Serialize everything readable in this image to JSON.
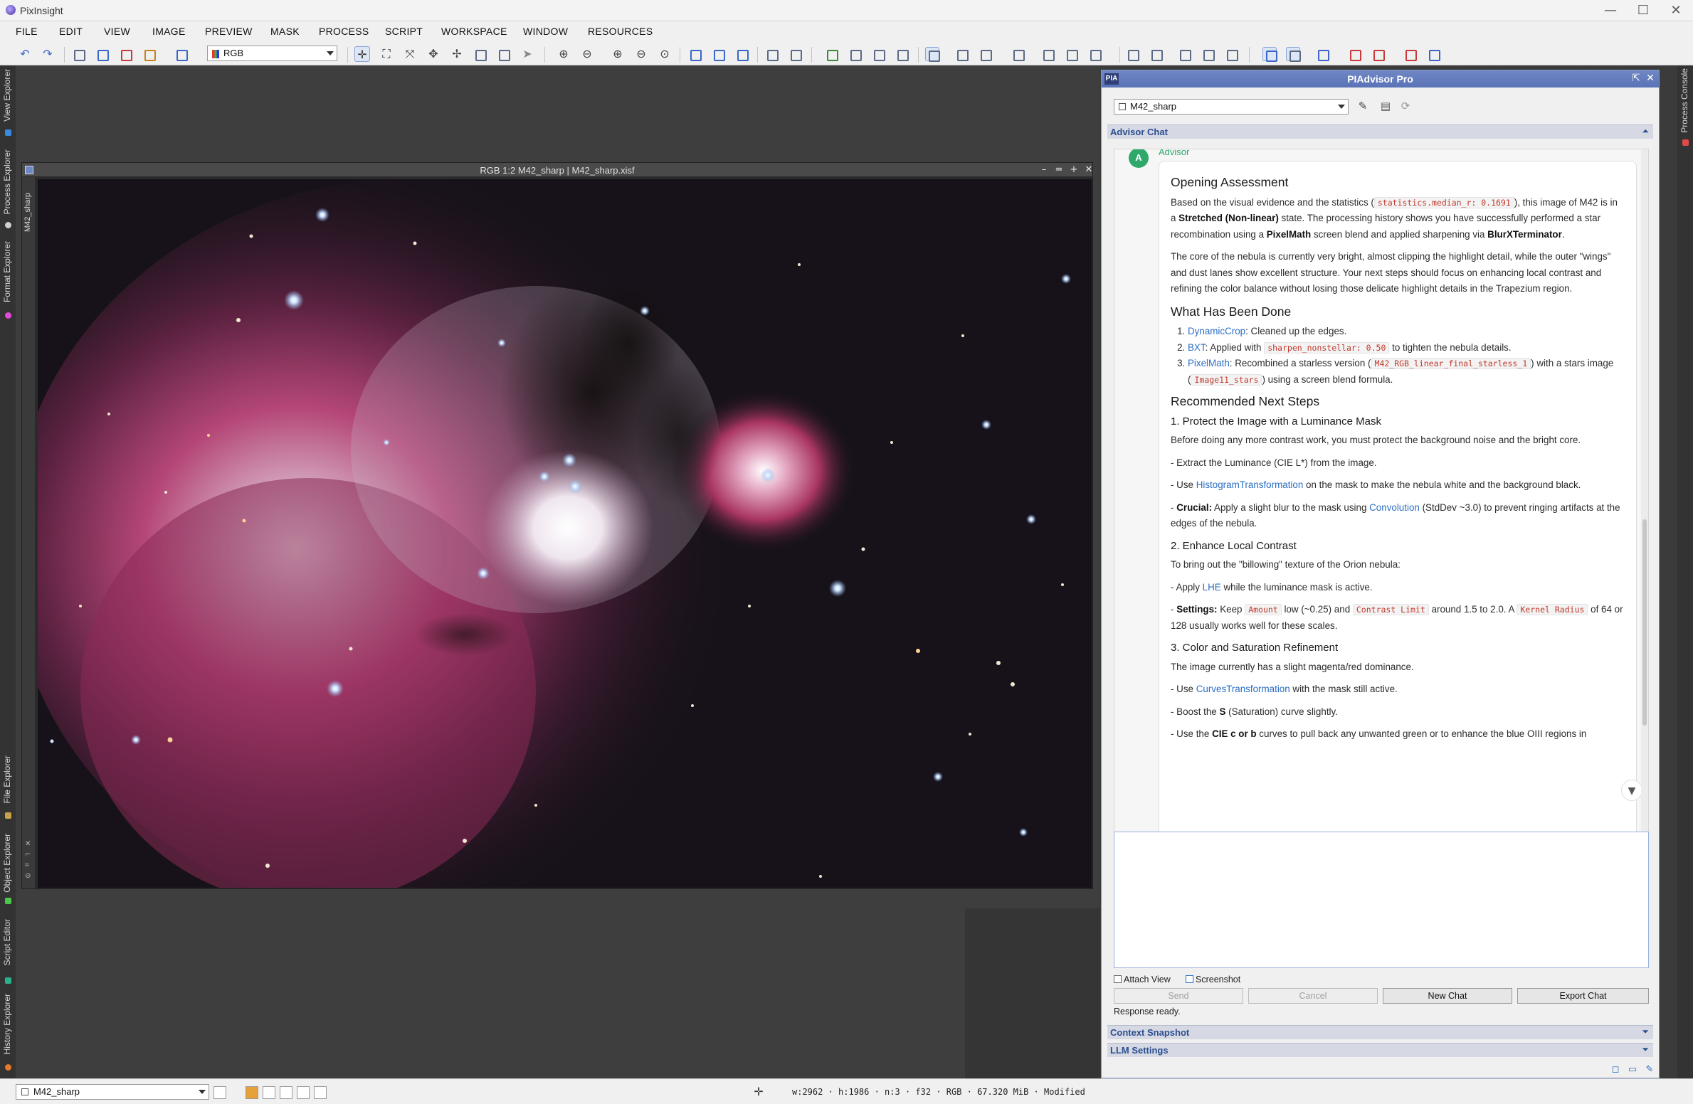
{
  "app": {
    "title": "PixInsight",
    "window_controls": [
      "—",
      "☐",
      "✕"
    ]
  },
  "menu": [
    "FILE",
    "EDIT",
    "VIEW",
    "IMAGE",
    "PREVIEW",
    "MASK",
    "PROCESS",
    "SCRIPT",
    "WORKSPACE",
    "WINDOW",
    "RESOURCES"
  ],
  "toolbar": {
    "color_space": "RGB"
  },
  "left_tabs": {
    "view_explorer": "View Explorer",
    "process_explorer": "Process Explorer",
    "format_explorer": "Format Explorer",
    "file_explorer": "File Explorer",
    "object_explorer": "Object Explorer",
    "script_editor": "Script Editor",
    "history_explorer": "History Explorer"
  },
  "right_tabs": {
    "process_console": "Process Console"
  },
  "image_window": {
    "title": "RGB 1:2 M42_sharp | M42_sharp.xisf",
    "side_label": "M42_sharp"
  },
  "advisor": {
    "badge": "PIA",
    "title": "PIAdvisor Pro",
    "view_select": "M42_sharp",
    "section_chat": "Advisor Chat",
    "section_context": "Context Snapshot",
    "section_llm": "LLM Settings",
    "author_initial": "A",
    "author_name": "Advisor",
    "msg": {
      "h_opening": "Opening Assessment",
      "p1a": "Based on the visual evidence and the statistics (",
      "p1_code": "statistics.median_r: 0.1691",
      "p1b": "), this image of M42 is in a ",
      "p1_bold1": "Stretched (Non-linear)",
      "p1c": " state. The processing history shows you have successfully performed a star recombination using a ",
      "p1_bold2": "PixelMath",
      "p1d": " screen blend and applied sharpening via ",
      "p1_bold3": "BlurXTerminator",
      "p1e": ".",
      "p2": "The core of the nebula is currently very bright, almost clipping the highlight detail, while the outer \"wings\" and dust lanes show excellent structure. Your next steps should focus on enhancing local contrast and refining the color balance without losing those delicate highlight details in the Trapezium region.",
      "h_done": "What Has Been Done",
      "done1_link": "DynamicCrop",
      "done1_text": ": Cleaned up the edges.",
      "done2_link": "BXT",
      "done2_text_a": ": Applied with ",
      "done2_code": "sharpen_nonstellar: 0.50",
      "done2_text_b": " to tighten the nebula details.",
      "done3_link": "PixelMath",
      "done3_text_a": ": Recombined a starless version (",
      "done3_code1": "M42_RGB_linear_final_starless_1",
      "done3_text_b": ") with a stars image (",
      "done3_code2": "Image11_stars",
      "done3_text_c": ") using a screen blend formula.",
      "h_next": "Recommended Next Steps",
      "h_step1": "1. Protect the Image with a Luminance Mask",
      "s1_p": "Before doing any more contrast work, you must protect the background noise and the bright core.",
      "s1_b1": "- Extract the Luminance (CIE L*) from the image.",
      "s1_b2a": "- Use ",
      "s1_b2_link": "HistogramTransformation",
      "s1_b2b": " on the mask to make the nebula white and the background black.",
      "s1_b3_bold": "Crucial:",
      "s1_b3a": " Apply a slight blur to the mask using ",
      "s1_b3_link": "Convolution",
      "s1_b3b": " (StdDev ~3.0) to prevent ringing artifacts at the edges of the nebula.",
      "h_step2": "2. Enhance Local Contrast",
      "s2_p": "To bring out the \"billowing\" texture of the Orion nebula:",
      "s2_b1a": "- Apply ",
      "s2_b1_link": "LHE",
      "s2_b1b": " while the luminance mask is active.",
      "s2_b2_bold": "Settings:",
      "s2_b2a": " Keep ",
      "s2_b2_code1": "Amount",
      "s2_b2b": " low (~0.25) and ",
      "s2_b2_code2": "Contrast Limit",
      "s2_b2c": " around 1.5 to 2.0. A ",
      "s2_b2_code3": "Kernel Radius",
      "s2_b2d": " of 64 or 128 usually works well for these scales.",
      "h_step3": "3. Color and Saturation Refinement",
      "s3_p": "The image currently has a slight magenta/red dominance.",
      "s3_b1a": "- Use ",
      "s3_b1_link": "CurvesTransformation",
      "s3_b1b": " with the mask still active.",
      "s3_b2a": "- Boost the ",
      "s3_b2_bold": "S",
      "s3_b2b": " (Saturation) curve slightly.",
      "s3_b3a": "- Use the ",
      "s3_b3_bold": "CIE c or b",
      "s3_b3b": " curves to pull back any unwanted green or to enhance the blue OIII regions in"
    },
    "attach_view": "Attach View",
    "screenshot": "Screenshot",
    "buttons": {
      "send": "Send",
      "cancel": "Cancel",
      "new_chat": "New Chat",
      "export_chat": "Export Chat"
    },
    "status": "Response ready."
  },
  "statusbar": {
    "view_select": "M42_sharp",
    "info": "w:2962 · h:1986 · n:3 · f32 · RGB · 67.320 MiB · Modified"
  },
  "colors": {
    "accent": "#2c6ec4",
    "panel_title": "#5a73b6",
    "advisor_green": "#2fa86a",
    "code_red": "#c0392b"
  }
}
